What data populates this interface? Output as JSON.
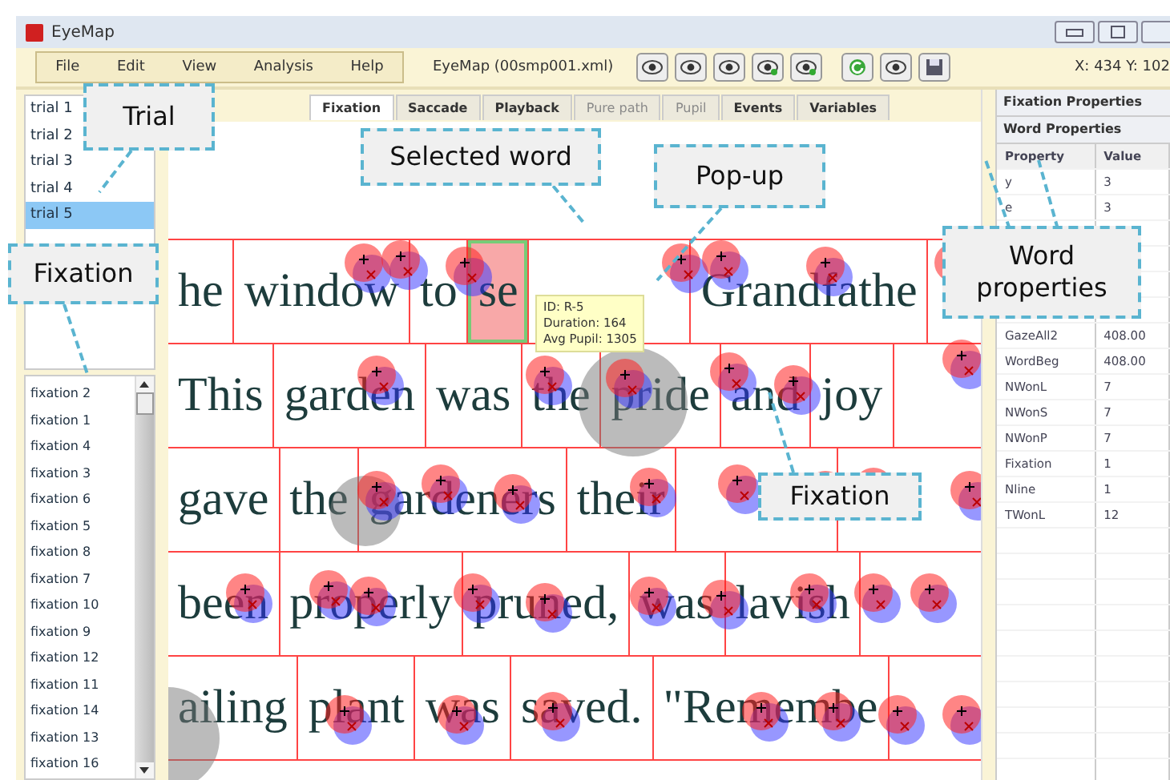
{
  "window": {
    "title": "EyeMap"
  },
  "menu": [
    "File",
    "Edit",
    "View",
    "Analysis",
    "Help"
  ],
  "document_title": "EyeMap (00smp001.xml)",
  "coordinates": "X: 434 Y: 102",
  "trials": [
    {
      "label": "trial 1",
      "selected": false
    },
    {
      "label": "trial 2",
      "selected": false
    },
    {
      "label": "trial 3",
      "selected": false
    },
    {
      "label": "trial 4",
      "selected": false
    },
    {
      "label": "trial 5",
      "selected": true
    }
  ],
  "fixations": [
    "fixation 2",
    "fixation 1",
    "fixation 4",
    "fixation 3",
    "fixation 6",
    "fixation 5",
    "fixation 8",
    "fixation 7",
    "fixation 10",
    "fixation 9",
    "fixation 12",
    "fixation 11",
    "fixation 14",
    "fixation 13",
    "fixation 16"
  ],
  "tabs": [
    {
      "label": "Fixation",
      "selected": true,
      "disabled": false
    },
    {
      "label": "Saccade",
      "selected": false,
      "disabled": false
    },
    {
      "label": "Playback",
      "selected": false,
      "disabled": false
    },
    {
      "label": "Pure path",
      "selected": false,
      "disabled": true
    },
    {
      "label": "Pupil",
      "selected": false,
      "disabled": true
    },
    {
      "label": "Events",
      "selected": false,
      "disabled": false
    },
    {
      "label": "Variables",
      "selected": false,
      "disabled": false
    }
  ],
  "text_lines": [
    {
      "words": [
        {
          "text": "he",
          "selected": false
        },
        {
          "text": "window",
          "selected": false
        },
        {
          "text": "to",
          "selected": false
        },
        {
          "text": "se",
          "selected": true
        },
        {
          "kind": "gap"
        },
        {
          "text": "Grandfathe",
          "selected": false
        }
      ]
    },
    {
      "words": [
        {
          "text": "This",
          "selected": false
        },
        {
          "text": "garden",
          "selected": false
        },
        {
          "text": "was",
          "selected": false
        },
        {
          "text": "the",
          "selected": false
        },
        {
          "text": "pride",
          "selected": false
        },
        {
          "text": "and",
          "selected": false
        },
        {
          "text": "joy",
          "selected": false
        }
      ]
    },
    {
      "words": [
        {
          "text": "gave",
          "selected": false
        },
        {
          "text": "the",
          "selected": false
        },
        {
          "text": "gardeners",
          "selected": false
        },
        {
          "text": "their",
          "selected": false
        },
        {
          "kind": "gap"
        }
      ]
    },
    {
      "words": [
        {
          "text": "been",
          "selected": false
        },
        {
          "text": "properly",
          "selected": false
        },
        {
          "text": "pruned,",
          "selected": false
        },
        {
          "text": "was",
          "selected": false
        },
        {
          "text": "lavish",
          "selected": false
        }
      ]
    },
    {
      "words": [
        {
          "text": "ailing",
          "selected": false
        },
        {
          "text": "plant",
          "selected": false
        },
        {
          "text": "was",
          "selected": false
        },
        {
          "text": "saved.",
          "selected": false
        },
        {
          "text": "\"Remembe",
          "selected": false
        }
      ]
    }
  ],
  "tooltip": [
    "ID: R-5",
    "Duration: 164",
    "Avg Pupil: 1305"
  ],
  "properties": {
    "headers": [
      "Fixation Properties",
      "Word Properties"
    ],
    "columns": [
      "Property",
      "Value"
    ],
    "rows": [
      {
        "property": "y",
        "value": "3"
      },
      {
        "property": "e",
        "value": "3"
      },
      {
        "property": "GazeAll2",
        "value": "408.00"
      },
      {
        "property": "WordBeg",
        "value": "408.00"
      },
      {
        "property": "NWonL",
        "value": "7"
      },
      {
        "property": "NWonS",
        "value": "7"
      },
      {
        "property": "NWonP",
        "value": "7"
      },
      {
        "property": "Fixation",
        "value": "1"
      },
      {
        "property": "Nline",
        "value": "1"
      },
      {
        "property": "TWonL",
        "value": "12"
      }
    ]
  },
  "callouts": [
    "Trial",
    "Selected word",
    "Pop-up",
    "Fixation",
    "Fixation",
    "Word properties"
  ]
}
